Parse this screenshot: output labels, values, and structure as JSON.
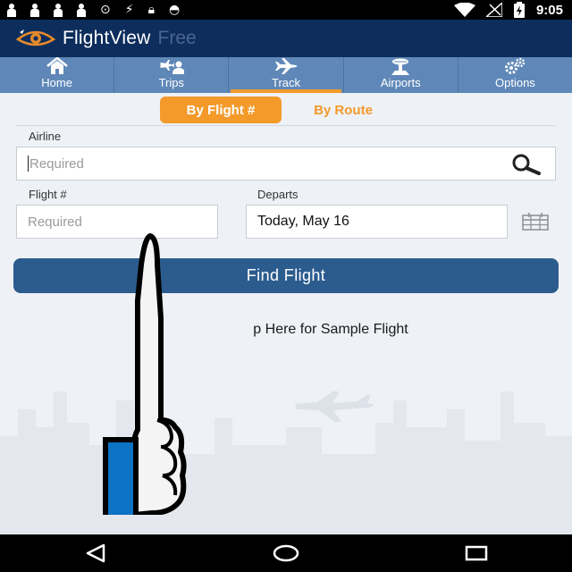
{
  "status_bar": {
    "time": "9:05",
    "icons": [
      "notification-pawn-icon",
      "notification-pawn-icon",
      "notification-pawn-icon",
      "notification-pawn-icon",
      "sync-icon",
      "no-sim-satellite-icon",
      "lock-icon",
      "android-icon"
    ],
    "right_icons": [
      "wifi-icon",
      "no-signal-icon",
      "battery-charging-icon"
    ]
  },
  "app_bar": {
    "title": "FlightView",
    "suffix": "Free"
  },
  "tabs": [
    {
      "label": "Home",
      "icon": "home-icon"
    },
    {
      "label": "Trips",
      "icon": "trips-icon"
    },
    {
      "label": "Track",
      "icon": "plane-icon",
      "active": true
    },
    {
      "label": "Airports",
      "icon": "airport-icon"
    },
    {
      "label": "Options",
      "icon": "gears-icon"
    }
  ],
  "segmented": {
    "by_flight": "By Flight #",
    "by_route": "By Route"
  },
  "form": {
    "airline_label": "Airline",
    "airline_placeholder": "Required",
    "flight_label": "Flight #",
    "flight_placeholder": "Required",
    "departs_label": "Departs",
    "departs_value": "Today, May 16"
  },
  "find_button": "Find Flight",
  "sample_link": "p Here for Sample Flight",
  "colors": {
    "app_bar": "#0d2d5c",
    "tab_bar": "#5f88b8",
    "accent": "#f39a2b",
    "button": "#2c5c8e"
  }
}
